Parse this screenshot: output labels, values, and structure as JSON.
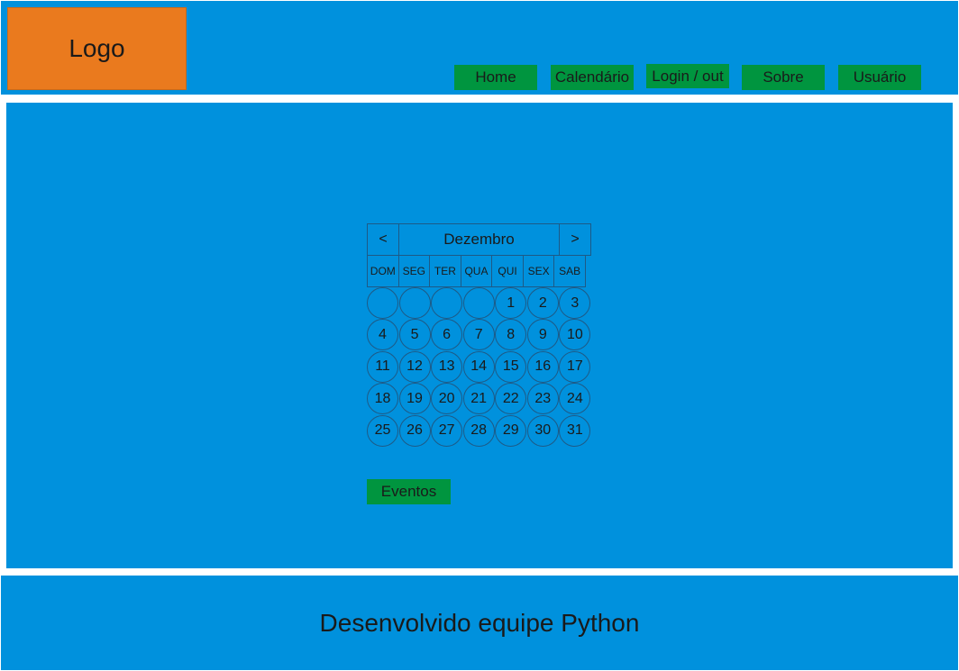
{
  "header": {
    "logo_label": "Logo",
    "nav": [
      {
        "label": "Home"
      },
      {
        "label": "Calendário"
      },
      {
        "label": "Login / out"
      },
      {
        "label": "Sobre"
      },
      {
        "label": "Usuário"
      }
    ]
  },
  "calendar": {
    "prev_label": "<",
    "next_label": ">",
    "month": "Dezembro",
    "weekdays": [
      "DOM",
      "SEG",
      "TER",
      "QUA",
      "QUI",
      "SEX",
      "SAB"
    ],
    "days": [
      "",
      "",
      "",
      "",
      "1",
      "2",
      "3",
      "4",
      "5",
      "6",
      "7",
      "8",
      "9",
      "10",
      "11",
      "12",
      "13",
      "14",
      "15",
      "16",
      "17",
      "18",
      "19",
      "20",
      "21",
      "22",
      "23",
      "24",
      "25",
      "26",
      "27",
      "28",
      "29",
      "30",
      "31"
    ]
  },
  "events_label": "Eventos",
  "footer": {
    "text": "Desenvolvido equipe Python"
  },
  "colors": {
    "panel_blue": "#0091dd",
    "logo_orange": "#ea7a1e",
    "button_green": "#00953f"
  }
}
